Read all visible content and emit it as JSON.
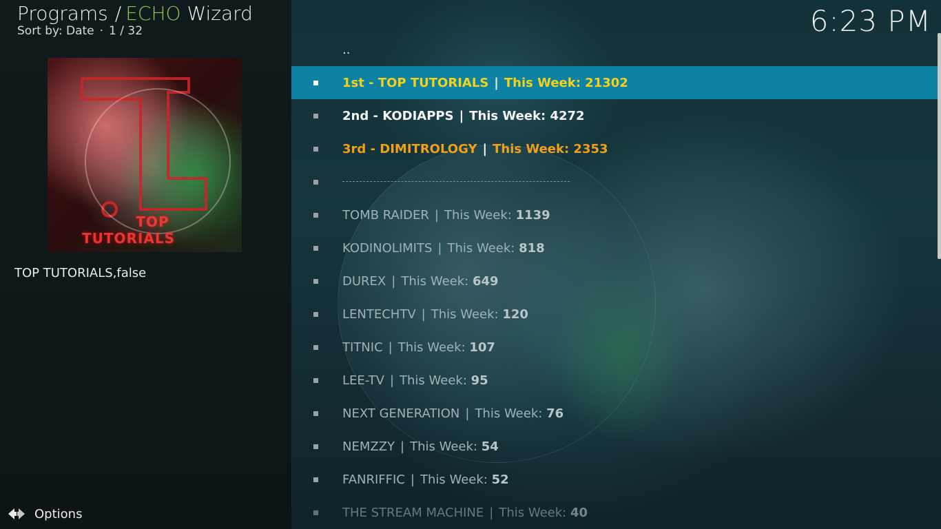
{
  "header": {
    "section": "Programs",
    "separator": "/",
    "addon_prefix": "ECHO",
    "addon_suffix": "Wizard",
    "sort_label": "Sort by: Date",
    "dot": "·",
    "position": "1 / 32"
  },
  "clock": "6:23 PM",
  "preview": {
    "logo_line1": "TOP",
    "logo_line2": "TUTORIALS",
    "label": "TOP TUTORIALS,false"
  },
  "options": {
    "label": "Options",
    "icon": "options-arrows-icon"
  },
  "list": {
    "parent": "..",
    "pipe": "|",
    "top": [
      {
        "name": "1st - TOP TUTORIALS",
        "week": "This Week: 21302"
      },
      {
        "name": "2nd - KODIAPPS",
        "week": "This Week: 4272"
      },
      {
        "name": "3rd - DIMITROLOGY",
        "week": "This Week: 2353"
      }
    ],
    "items": [
      {
        "name": "TOMB RAIDER",
        "week_label": "This Week:",
        "count": "1139"
      },
      {
        "name": "KODINOLIMITS",
        "week_label": "This Week:",
        "count": "818"
      },
      {
        "name": "DUREX",
        "week_label": "This Week:",
        "count": "649"
      },
      {
        "name": "LENTECHTV",
        "week_label": "This Week:",
        "count": "120"
      },
      {
        "name": "TITNIC",
        "week_label": "This Week:",
        "count": "107"
      },
      {
        "name": "LEE-TV",
        "week_label": "This Week:",
        "count": "95"
      },
      {
        "name": "NEXT GENERATION",
        "week_label": "This Week:",
        "count": "76"
      },
      {
        "name": "NEMZZY",
        "week_label": "This Week:",
        "count": "54"
      },
      {
        "name": "FANRIFFIC",
        "week_label": "This Week:",
        "count": "52"
      },
      {
        "name": "THE STREAM MACHINE",
        "week_label": "This Week:",
        "count": "40"
      }
    ]
  },
  "colors": {
    "selection": "#0e82a4",
    "first": "#f3d21a",
    "third": "#f0a01c",
    "echo": "#8fc549"
  }
}
